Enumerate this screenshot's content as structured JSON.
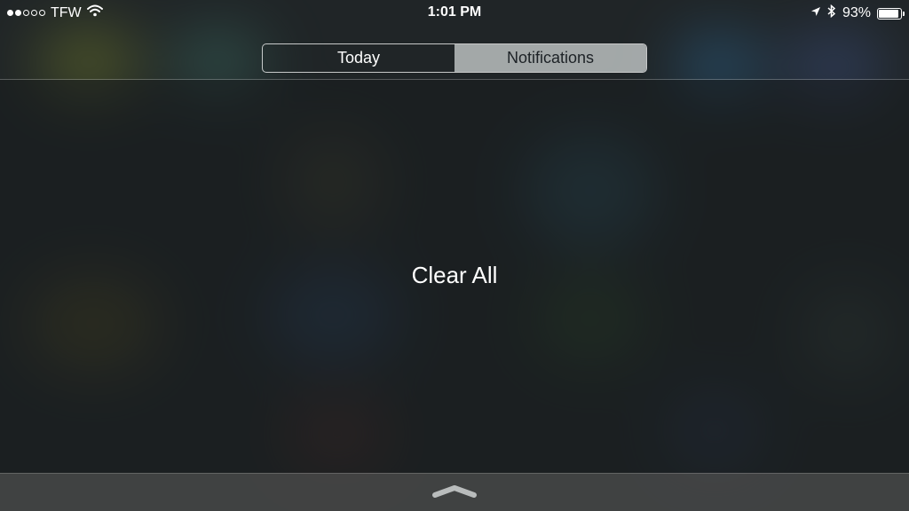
{
  "status_bar": {
    "carrier": "TFW",
    "time": "1:01 PM",
    "battery_percent": "93%",
    "battery_level": 0.93,
    "signal_bars_filled": 2,
    "signal_bars_total": 5,
    "icons": [
      "signal-dots-icon",
      "wifi-icon",
      "location-arrow-icon",
      "bluetooth-icon",
      "battery-icon"
    ]
  },
  "segmented_control": {
    "tabs": [
      {
        "label": "Today",
        "selected": false
      },
      {
        "label": "Notifications",
        "selected": true
      }
    ]
  },
  "main": {
    "clear_all_label": "Clear All"
  },
  "bottom": {
    "grabber_icon": "chevron-up-icon"
  },
  "colors": {
    "selected_segment": "#c8cdcd",
    "text": "#ffffff"
  }
}
